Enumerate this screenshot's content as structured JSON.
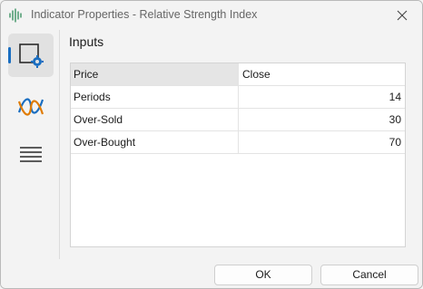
{
  "window": {
    "title": "Indicator Properties - Relative Strength Index"
  },
  "sidebar": {
    "items": [
      {
        "icon": "settings-square-icon",
        "active": true
      },
      {
        "icon": "wave-icon",
        "active": false
      },
      {
        "icon": "levels-lines-icon",
        "active": false
      }
    ],
    "accent_color": "#1a6ec1"
  },
  "section": {
    "title": "Inputs"
  },
  "inputs": [
    {
      "label": "Price",
      "value": "Close"
    },
    {
      "label": "Periods",
      "value": "14"
    },
    {
      "label": "Over-Sold",
      "value": "30"
    },
    {
      "label": "Over-Bought",
      "value": "70"
    }
  ],
  "buttons": {
    "ok": "OK",
    "cancel": "Cancel"
  }
}
